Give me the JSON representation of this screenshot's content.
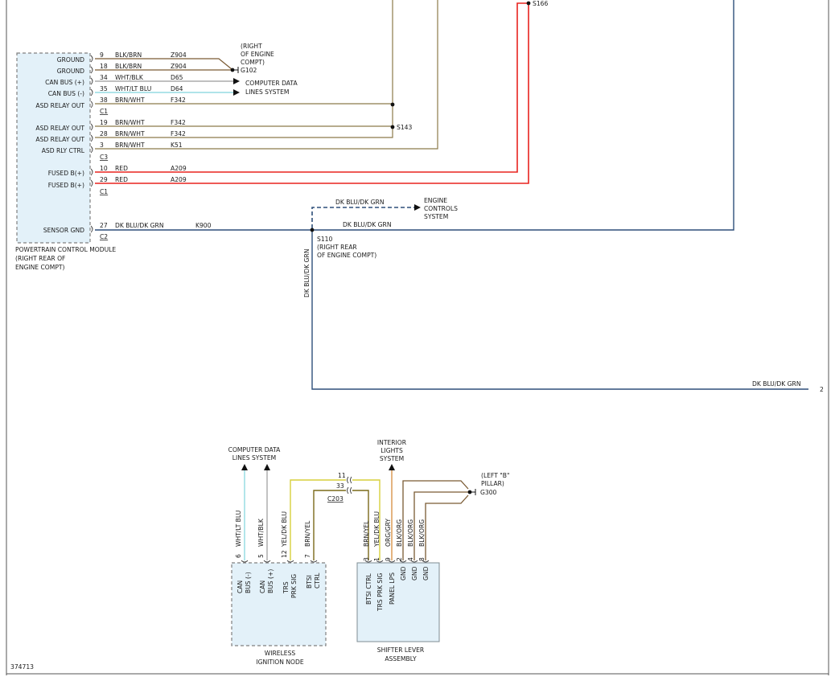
{
  "diagram_id": "374713",
  "colors": {
    "brown": "#7a5a33",
    "tan": "#8c7a4a",
    "gray": "#9a9a9a",
    "lt_blue": "#7fd4dc",
    "red": "#e8231f",
    "dk_blue": "#2e4f7a",
    "yellow": "#d7cf3c",
    "orange": "#d8944a",
    "box_fill": "#e3f1f9"
  },
  "pcm": {
    "title_lines": [
      "POWERTRAIN CONTROL MODULE",
      "(RIGHT REAR OF",
      "ENGINE COMPT)"
    ],
    "pins": [
      {
        "label": "GROUND",
        "num": "9",
        "color": "BLK/BRN",
        "circuit": "Z904"
      },
      {
        "label": "GROUND",
        "num": "18",
        "color": "BLK/BRN",
        "circuit": "Z904"
      },
      {
        "label": "CAN BUS (+)",
        "num": "34",
        "color": "WHT/BLK",
        "circuit": "D65"
      },
      {
        "label": "CAN BUS (-)",
        "num": "35",
        "color": "WHT/LT BLU",
        "circuit": "D64"
      },
      {
        "label": "ASD RELAY OUT",
        "num": "38",
        "color": "BRN/WHT",
        "circuit": "F342"
      },
      {
        "label": "ASD RELAY OUT",
        "num": "19",
        "color": "BRN/WHT",
        "circuit": "F342"
      },
      {
        "label": "ASD RELAY OUT",
        "num": "28",
        "color": "BRN/WHT",
        "circuit": "F342"
      },
      {
        "label": "ASD RLY CTRL",
        "num": "3",
        "color": "BRN/WHT",
        "circuit": "K51"
      },
      {
        "label": "FUSED B(+)",
        "num": "10",
        "color": "RED",
        "circuit": "A209"
      },
      {
        "label": "FUSED B(+)",
        "num": "29",
        "color": "RED",
        "circuit": "A209"
      },
      {
        "label": "SENSOR GND",
        "num": "27",
        "color": "DK BLU/DK GRN",
        "circuit": "K900"
      }
    ],
    "connectors": [
      "C1",
      "C3",
      "C1",
      "C2"
    ]
  },
  "ground_g102": {
    "location_lines": [
      "(RIGHT",
      "OF ENGINE",
      "COMPT)"
    ],
    "id": "G102"
  },
  "computer_data_top": {
    "lines": [
      "COMPUTER DATA",
      "LINES SYSTEM"
    ]
  },
  "splices": {
    "s143": "S143",
    "s166": "S166",
    "s110": "S110",
    "s110_location": [
      "(RIGHT REAR",
      "OF ENGINE COMPT)"
    ]
  },
  "engine_controls": {
    "lines": [
      "ENGINE",
      "CONTROLS",
      "SYSTEM"
    ],
    "wire_label": "DK BLU/DK GRN"
  },
  "sensor_run": {
    "label_mid": "DK BLU/DK GRN",
    "label_vertical": "DK BLU/DK GRN",
    "label_bottom": "DK BLU/DK GRN",
    "page_ref": "2"
  },
  "computer_data_bottom": {
    "lines": [
      "COMPUTER DATA",
      "LINES SYSTEM"
    ]
  },
  "interior_lights": {
    "lines": [
      "INTERIOR",
      "LIGHTS",
      "SYSTEM"
    ]
  },
  "ground_g300": {
    "location_lines": [
      "(LEFT \"B\"",
      "PILLAR)"
    ],
    "id": "G300"
  },
  "c203": {
    "pins": [
      "11",
      "33"
    ],
    "name": "C203"
  },
  "win": {
    "title_lines": [
      "WIRELESS",
      "IGNITION NODE"
    ],
    "pins": [
      {
        "num": "6",
        "wire": "WHT/LT BLU",
        "label": [
          "CAN",
          "BUS (-)"
        ]
      },
      {
        "num": "5",
        "wire": "WHT/BLK",
        "label": [
          "CAN",
          "BUS (+)"
        ]
      },
      {
        "num": "12",
        "wire": "YEL/DK BLU",
        "label": [
          "TRS",
          "PRK SIG"
        ]
      },
      {
        "num": "7",
        "wire": "BRN/YEL",
        "label": [
          "BTSI",
          "CTRL"
        ]
      }
    ]
  },
  "shifter": {
    "title_lines": [
      "SHIFTER LEVER",
      "ASSEMBLY"
    ],
    "pins": [
      {
        "num": "3",
        "wire": "BRN/YEL",
        "label": "BTSI CTRL"
      },
      {
        "num": "1",
        "wire": "YEL/DK BLU",
        "label": "TRS PRK SIG"
      },
      {
        "num": "9",
        "wire": "ORG/GRY",
        "label": "PANEL LPS"
      },
      {
        "num": "2",
        "wire": "BLK/ORG",
        "label": "GND"
      },
      {
        "num": "4",
        "wire": "BLK/ORG",
        "label": "GND"
      },
      {
        "num": "8",
        "wire": "BLK/ORG",
        "label": "GND"
      }
    ]
  }
}
